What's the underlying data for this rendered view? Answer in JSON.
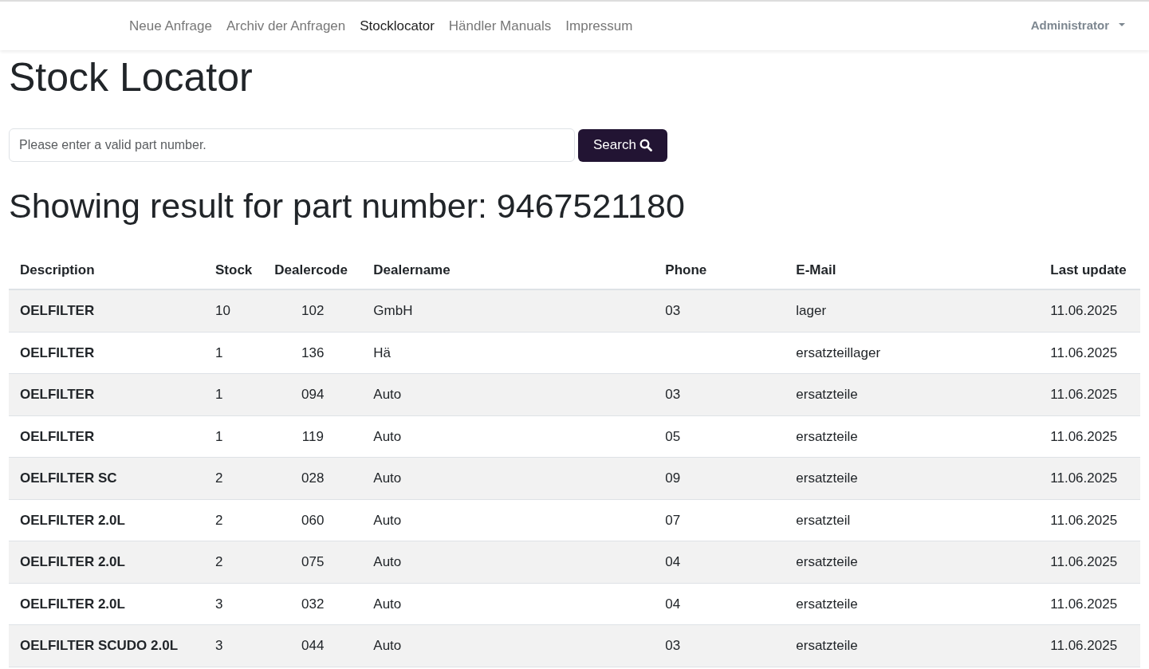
{
  "nav": {
    "links": [
      {
        "label": "Neue Anfrage",
        "selected": false
      },
      {
        "label": "Archiv der Anfragen",
        "selected": false
      },
      {
        "label": "Stocklocator",
        "selected": true
      },
      {
        "label": "Händler Manuals",
        "selected": false
      },
      {
        "label": "Impressum",
        "selected": false
      }
    ],
    "user_menu": "Administrator"
  },
  "title": "Stock Locator",
  "search": {
    "placeholder": "Please enter a valid part number.",
    "button": "Search"
  },
  "result_heading": "Showing result for part number: 9467521180",
  "table": {
    "columns": [
      "Description",
      "Stock",
      "Dealercode",
      "Dealername",
      "Phone",
      "E-Mail",
      "Last update"
    ],
    "rows": [
      [
        "OELFILTER",
        "10",
        "102",
        "GmbH",
        "03",
        "lager",
        "11.06.2025"
      ],
      [
        "OELFILTER",
        "1",
        "136",
        "Hä",
        "",
        "ersatzteillager",
        "11.06.2025"
      ],
      [
        "OELFILTER",
        "1",
        "094",
        "Auto",
        "03",
        "ersatzteile",
        "11.06.2025"
      ],
      [
        "OELFILTER",
        "1",
        "119",
        "Auto",
        "05",
        "ersatzteile",
        "11.06.2025"
      ],
      [
        "OELFILTER SC",
        "2",
        "028",
        "Auto",
        "09",
        "ersatzteile",
        "11.06.2025"
      ],
      [
        "OELFILTER 2.0L",
        "2",
        "060",
        "Auto",
        "07",
        "ersatzteil",
        "11.06.2025"
      ],
      [
        "OELFILTER 2.0L",
        "2",
        "075",
        "Auto",
        "04",
        "ersatzteile",
        "11.06.2025"
      ],
      [
        "OELFILTER 2.0L",
        "3",
        "032",
        "Auto",
        "04",
        "ersatzteile",
        "11.06.2025"
      ],
      [
        "OELFILTER SCUDO 2.0L",
        "3",
        "044",
        "Auto",
        "03",
        "ersatzteile",
        "11.06.2025"
      ]
    ]
  }
}
